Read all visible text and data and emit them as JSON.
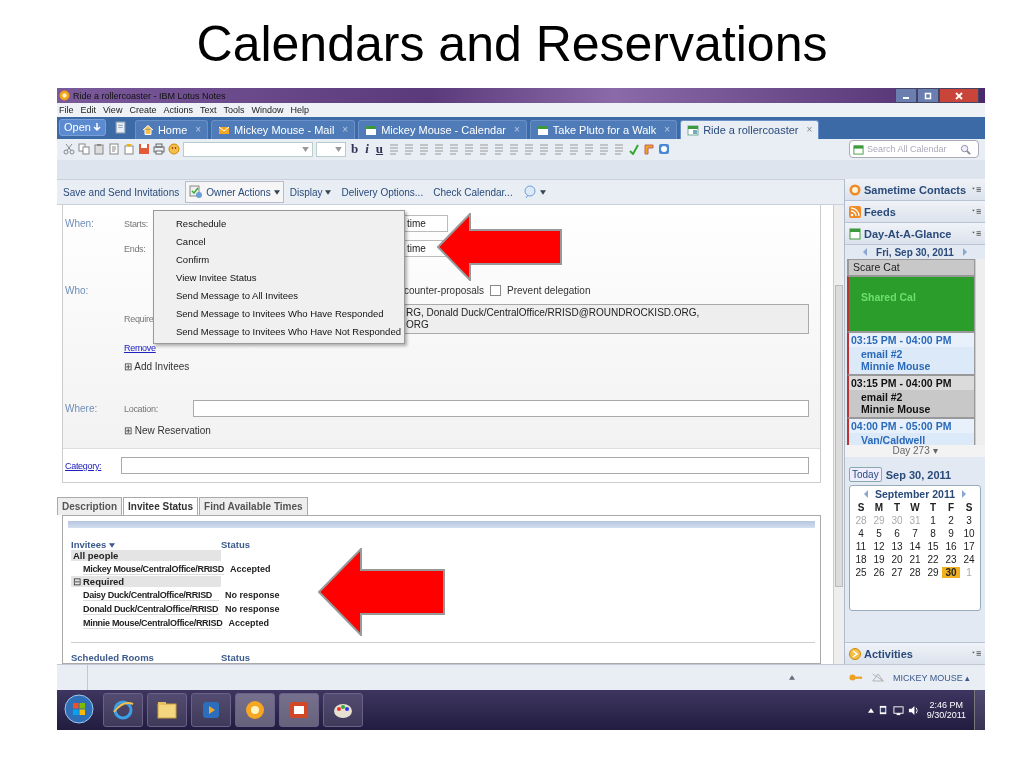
{
  "slide_title": "Calendars and Reservations",
  "window": {
    "title": "Ride a rollercoaster - IBM Lotus Notes"
  },
  "menu_bar": [
    "File",
    "Edit",
    "View",
    "Create",
    "Actions",
    "Text",
    "Tools",
    "Window",
    "Help"
  ],
  "open_button": {
    "label": "Open"
  },
  "tabs": [
    {
      "label": "Home",
      "kind": "home",
      "close": "×",
      "selected": false
    },
    {
      "label": "Mickey Mouse - Mail",
      "kind": "mail",
      "close": "×",
      "selected": false
    },
    {
      "label": "Mickey Mouse - Calendar",
      "kind": "calendar",
      "close": "×",
      "selected": false
    },
    {
      "label": "Take Pluto for a Walk",
      "kind": "calendar",
      "close": "×",
      "selected": false
    },
    {
      "label": "Ride a rollercoaster",
      "kind": "event",
      "close": "×",
      "selected": true
    }
  ],
  "toolbar": {
    "format_buttons": [
      "b",
      "i",
      "u"
    ],
    "search": {
      "placeholder": "Search All Calendar"
    }
  },
  "action_bar": [
    {
      "label": "Save and Send Invitations",
      "kind": "plain",
      "open": false
    },
    {
      "label": "Owner Actions",
      "kind": "icon-menu",
      "open": true
    },
    {
      "label": "Display",
      "kind": "menu",
      "open": false
    },
    {
      "label": "Delivery Options...",
      "kind": "plain",
      "open": false
    },
    {
      "label": "Check Calendar...",
      "kind": "plain",
      "open": false
    },
    {
      "kind": "search-menu",
      "open": false
    }
  ],
  "owner_actions_menu": [
    "Reschedule",
    "Cancel",
    "Confirm",
    "View Invitee Status",
    "Send Message to All Invitees",
    "Send Message to Invitees Who Have Responded",
    "Send Message to Invitees Who Have Not Responded"
  ],
  "form": {
    "when_label": "When:",
    "starts_label": "Starts:",
    "starts_value": "time",
    "ends_label": "Ends:",
    "ends_value": "time",
    "who_label": "Who:",
    "counter_proposals": "counter-proposals",
    "prevent_delegation": {
      "label": "Prevent delegation",
      "checked": false
    },
    "required_label": "Require",
    "required_value": [
      "RG, Donald Duck/CentralOffice/RRISD@ROUNDROCKISD.ORG,",
      "ORG"
    ],
    "remove_link": "Remove",
    "add_invitees": {
      "icon": "⊞",
      "label": "Add Invitees"
    },
    "where_label": "Where:",
    "location_label": "Location:",
    "new_reservation": {
      "icon": "⊞",
      "label": "New Reservation"
    },
    "category_link": "Category:"
  },
  "detail_tabs": [
    {
      "label": "Description",
      "selected": false
    },
    {
      "label": "Invitee Status",
      "selected": true
    },
    {
      "label": "Find Available Times",
      "selected": false
    }
  ],
  "invitee_status": {
    "columns": [
      "Invitees",
      "Status"
    ],
    "groups": [
      {
        "label": "All people",
        "members": [
          {
            "name": "Mickey Mouse/CentralOffice/RRISD",
            "status": "Accepted"
          }
        ]
      },
      {
        "toggle": "⊟",
        "label": "Required",
        "members": [
          {
            "name": "Daisy Duck/CentralOffice/RRISD",
            "status": "No response"
          },
          {
            "name": "Donald Duck/CentralOffice/RRISD",
            "status": "No response"
          },
          {
            "name": "Minnie Mouse/CentralOffice/RRISD",
            "status": "Accepted"
          }
        ]
      }
    ],
    "rooms_columns": [
      "Scheduled Rooms",
      "Status"
    ]
  },
  "sidebar": {
    "panels": [
      {
        "title": "Sametime Contacts",
        "kind": "sametime"
      },
      {
        "title": "Feeds",
        "kind": "feeds"
      }
    ],
    "day_at_a_glance": {
      "title": "Day-At-A-Glance",
      "date": "Fri, Sep 30, 2011",
      "footer": "Day 273 ▾",
      "entries": [
        {
          "color": "#c8c8c8",
          "lines": [
            "Scare Cat"
          ],
          "selected": false
        },
        {
          "color": "#2a9d2a",
          "lines": [
            "Shared Cal"
          ],
          "selected": false
        },
        {
          "color": "#dbe9f9",
          "time": "03:15 PM - 04:00 PM",
          "lines": [
            "email #2",
            "Minnie Mouse"
          ],
          "selected": false
        },
        {
          "color": "#c8c8c8",
          "time": "03:15 PM - 04:00 PM",
          "lines": [
            "email #2",
            "Minnie Mouse"
          ],
          "selected": true
        },
        {
          "color": "#dbe9f9",
          "time": "04:00 PM - 05:00 PM",
          "lines": [
            "Van/Caldwell"
          ],
          "selected": false
        }
      ]
    },
    "today_button": "Today",
    "today_date": "Sep 30, 2011",
    "mini_calendar": {
      "month": "September 2011",
      "weekdays": [
        "S",
        "M",
        "T",
        "W",
        "T",
        "F",
        "S"
      ],
      "days": [
        {
          "label": "28",
          "muted": true,
          "selected": false
        },
        {
          "label": "29",
          "muted": true,
          "selected": false
        },
        {
          "label": "30",
          "muted": true,
          "selected": false
        },
        {
          "label": "31",
          "muted": true,
          "selected": false
        },
        {
          "label": "1",
          "muted": false,
          "selected": false
        },
        {
          "label": "2",
          "muted": false,
          "selected": false
        },
        {
          "label": "3",
          "muted": false,
          "selected": false
        },
        {
          "label": "4",
          "muted": false,
          "selected": false
        },
        {
          "label": "5",
          "muted": false,
          "selected": false
        },
        {
          "label": "6",
          "muted": false,
          "selected": false
        },
        {
          "label": "7",
          "muted": false,
          "selected": false
        },
        {
          "label": "8",
          "muted": false,
          "selected": false
        },
        {
          "label": "9",
          "muted": false,
          "selected": false
        },
        {
          "label": "10",
          "muted": false,
          "selected": false
        },
        {
          "label": "11",
          "muted": false,
          "selected": false
        },
        {
          "label": "12",
          "muted": false,
          "selected": false
        },
        {
          "label": "13",
          "muted": false,
          "selected": false
        },
        {
          "label": "14",
          "muted": false,
          "selected": false
        },
        {
          "label": "15",
          "muted": false,
          "selected": false
        },
        {
          "label": "16",
          "muted": false,
          "selected": false
        },
        {
          "label": "17",
          "muted": false,
          "selected": false
        },
        {
          "label": "18",
          "muted": false,
          "selected": false
        },
        {
          "label": "19",
          "muted": false,
          "selected": false
        },
        {
          "label": "20",
          "muted": false,
          "selected": false
        },
        {
          "label": "21",
          "muted": false,
          "selected": false
        },
        {
          "label": "22",
          "muted": false,
          "selected": false
        },
        {
          "label": "23",
          "muted": false,
          "selected": false
        },
        {
          "label": "24",
          "muted": false,
          "selected": false
        },
        {
          "label": "25",
          "muted": false,
          "selected": false
        },
        {
          "label": "26",
          "muted": false,
          "selected": false
        },
        {
          "label": "27",
          "muted": false,
          "selected": false
        },
        {
          "label": "28",
          "muted": false,
          "selected": false
        },
        {
          "label": "29",
          "muted": false,
          "selected": false
        },
        {
          "label": "30",
          "muted": false,
          "selected": true
        },
        {
          "label": "1",
          "muted": true,
          "selected": false
        }
      ]
    },
    "activities": "Activities"
  },
  "status_bar": {
    "user": "MICKEY MOUSE ▴"
  },
  "taskbar": {
    "time": "2:46 PM",
    "date": "9/30/2011"
  }
}
